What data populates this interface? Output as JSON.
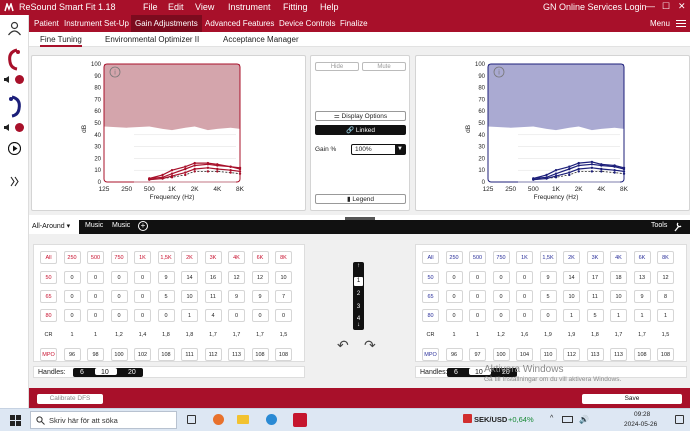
{
  "app": {
    "title": "ReSound Smart Fit 1.18",
    "menus": [
      "File",
      "Edit",
      "View",
      "Instrument",
      "Fitting",
      "Help"
    ],
    "account": "GN Online Services Login",
    "window_controls": [
      "—",
      "☐",
      "✕"
    ]
  },
  "nav": {
    "tabs": [
      "Patient",
      "Instrument Set-Up",
      "Gain Adjustments",
      "Advanced Features",
      "Device Controls",
      "Finalize"
    ],
    "active": "Gain Adjustments",
    "menu": "Menu"
  },
  "subtabs": {
    "items": [
      "Fine Tuning",
      "Environmental Optimizer II",
      "Acceptance Manager"
    ],
    "active": "Fine Tuning"
  },
  "charts": {
    "ylabel": "dB",
    "xlabel": "Frequency (Hz)",
    "y_ticks": [
      "100",
      "90",
      "80",
      "70",
      "60",
      "50",
      "40",
      "30",
      "20",
      "10",
      "0"
    ],
    "x_ticks": [
      "125",
      "250",
      "500",
      "1K",
      "2K",
      "4K",
      "8K"
    ],
    "info_glyph": "i"
  },
  "chart_data": [
    {
      "type": "line",
      "x": [
        500,
        750,
        1000,
        1500,
        2000,
        3000,
        4000,
        6000,
        8000
      ],
      "series": [
        {
          "values": [
            2,
            3,
            4,
            6,
            9,
            9,
            9,
            8,
            7
          ]
        },
        {
          "values": [
            2,
            3,
            5,
            8,
            11,
            12,
            11,
            10,
            9
          ]
        },
        {
          "values": [
            3,
            4,
            7,
            11,
            14,
            15,
            14,
            13,
            11
          ]
        },
        {
          "values": [
            3,
            6,
            10,
            13,
            16,
            16,
            15,
            13,
            12
          ]
        }
      ],
      "xlim": [
        125,
        8000
      ],
      "ylim": [
        0,
        100
      ],
      "xlabel": "Frequency (Hz)",
      "ylabel": "dB",
      "colors": {
        "line": "#a8102a",
        "shade": "#d4a5ac"
      }
    },
    {
      "type": "line",
      "x": [
        500,
        750,
        1000,
        1500,
        2000,
        3000,
        4000,
        6000,
        8000
      ],
      "series": [
        {
          "values": [
            2,
            3,
            4,
            6,
            9,
            9,
            9,
            8,
            7
          ]
        },
        {
          "values": [
            2,
            3,
            5,
            8,
            11,
            12,
            11,
            10,
            9
          ]
        },
        {
          "values": [
            3,
            4,
            7,
            11,
            14,
            15,
            14,
            13,
            11
          ]
        },
        {
          "values": [
            3,
            6,
            10,
            13,
            16,
            17,
            15,
            14,
            12
          ]
        }
      ],
      "xlim": [
        125,
        8000
      ],
      "ylim": [
        0,
        100
      ],
      "xlabel": "Frequency (Hz)",
      "ylabel": "dB",
      "colors": {
        "line": "#1c1f7a",
        "shade": "#aaaad2"
      }
    }
  ],
  "middle": {
    "hide": "Hide",
    "mute": "Mute",
    "display_options": "Display Options",
    "linked": "Linked",
    "gain_label": "Gain %",
    "gain_value": "100%",
    "legend": "Legend"
  },
  "program_bar": {
    "program": "All-Around",
    "tabs": [
      "Music",
      "Music"
    ],
    "add": "+",
    "tools": "Tools"
  },
  "gain_tables": {
    "left": {
      "header": [
        "All",
        "250",
        "500",
        "750",
        "1K",
        "1,5K",
        "2K",
        "3K",
        "4K",
        "6K",
        "8K"
      ],
      "rows": [
        {
          "label": "50",
          "values": [
            "0",
            "0",
            "0",
            "0",
            "9",
            "14",
            "16",
            "12",
            "12",
            "10"
          ]
        },
        {
          "label": "65",
          "values": [
            "0",
            "0",
            "0",
            "0",
            "5",
            "10",
            "11",
            "9",
            "9",
            "7"
          ]
        },
        {
          "label": "80",
          "values": [
            "0",
            "0",
            "0",
            "0",
            "0",
            "1",
            "4",
            "0",
            "0",
            "0"
          ]
        }
      ],
      "cr": {
        "label": "CR",
        "values": [
          "1",
          "1",
          "1,2",
          "1,4",
          "1,8",
          "1,8",
          "1,7",
          "1,7",
          "1,7",
          "1,5"
        ]
      },
      "mpo": {
        "label": "MPO",
        "values": [
          "96",
          "98",
          "100",
          "102",
          "108",
          "111",
          "112",
          "113",
          "108",
          "108"
        ]
      }
    },
    "right": {
      "header": [
        "All",
        "250",
        "500",
        "750",
        "1K",
        "1,5K",
        "2K",
        "3K",
        "4K",
        "6K",
        "8K"
      ],
      "rows": [
        {
          "label": "50",
          "values": [
            "0",
            "0",
            "0",
            "0",
            "9",
            "14",
            "17",
            "18",
            "13",
            "12"
          ]
        },
        {
          "label": "65",
          "values": [
            "0",
            "0",
            "0",
            "0",
            "5",
            "10",
            "11",
            "10",
            "9",
            "8"
          ]
        },
        {
          "label": "80",
          "values": [
            "0",
            "0",
            "0",
            "0",
            "0",
            "1",
            "5",
            "1",
            "1",
            "1"
          ]
        }
      ],
      "cr": {
        "label": "CR",
        "values": [
          "1",
          "1",
          "1,2",
          "1,6",
          "1,9",
          "1,9",
          "1,8",
          "1,7",
          "1,7",
          "1,5"
        ]
      },
      "mpo": {
        "label": "MPO",
        "values": [
          "96",
          "97",
          "100",
          "104",
          "110",
          "112",
          "113",
          "113",
          "108",
          "108"
        ]
      }
    }
  },
  "handles": {
    "label": "Handles:",
    "options": [
      "6",
      "10",
      "20"
    ],
    "selected": "10"
  },
  "vertical_selector": {
    "options": [
      "1",
      "2",
      "3",
      "4"
    ],
    "selected": "1",
    "up": "↑",
    "down": "↓"
  },
  "undo": "↶",
  "redo": "↷",
  "footer": {
    "calibrate": "Calibrate DFS",
    "save": "Save"
  },
  "watermark": {
    "title": "Aktivera Windows",
    "subtitle": "Gå till Inställningar om du vill aktivera Windows."
  },
  "taskbar": {
    "search_placeholder": "Skriv här för att söka",
    "ticker": "SEK/USD",
    "change": "+0,64%",
    "time": "09:28",
    "date": "2024-05-26"
  }
}
